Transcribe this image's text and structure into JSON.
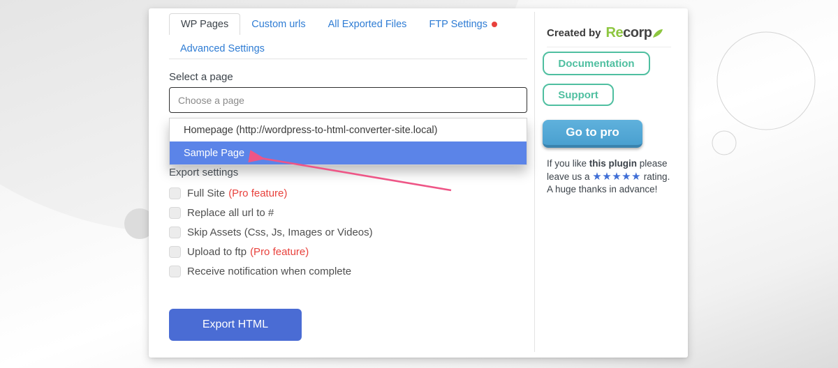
{
  "tabs": {
    "items": [
      {
        "label": "WP Pages",
        "active": true
      },
      {
        "label": "Custom urls",
        "active": false
      },
      {
        "label": "All Exported Files",
        "active": false
      },
      {
        "label": "FTP Settings",
        "active": false,
        "badge": "red-dot"
      },
      {
        "label": "Advanced Settings",
        "active": false
      }
    ]
  },
  "page_select": {
    "label": "Select a page",
    "placeholder": "Choose a page",
    "options": [
      {
        "label": "Homepage (http://wordpress-to-html-converter-site.local)",
        "highlighted": false
      },
      {
        "label": "Sample Page",
        "highlighted": true
      }
    ]
  },
  "export_settings": {
    "heading": "Export settings",
    "options": [
      {
        "label": "Full Site",
        "pro_note": "(Pro feature)",
        "checked": false
      },
      {
        "label": "Replace all url to #",
        "checked": false
      },
      {
        "label": "Skip Assets (Css, Js, Images or Videos)",
        "checked": false
      },
      {
        "label": "Upload to ftp",
        "pro_note": "(Pro feature)",
        "checked": false
      },
      {
        "label": "Receive notification when complete",
        "checked": false
      }
    ],
    "export_button_label": "Export HTML"
  },
  "sidebar": {
    "created_by_label": "Created by",
    "brand_name_part1": "Re",
    "brand_name_part2": "corp",
    "documentation_button_label": "Documentation",
    "support_button_label": "Support",
    "go_to_pro_button_label": "Go to pro",
    "rating_text": {
      "before_bold": "If you like ",
      "bold": "this plugin",
      "after_bold": " please leave us a ",
      "stars": "★★★★★",
      "after_stars": " rating.",
      "thanks_line": "A huge thanks in advance!"
    }
  },
  "icons": {
    "leaf": "leaf-icon",
    "ftp_notification": "notification-dot",
    "annotation": "selection-arrow"
  },
  "colors": {
    "link_blue": "#2e7cd4",
    "active_tab_text": "#3c434a",
    "notification_dot_red": "#e8413c",
    "pro_feature_red": "#e8413c",
    "dropdown_highlight_blue": "#5b84e8",
    "export_button_blue": "#4a6cd4",
    "brand_green": "#8dc63f",
    "teal_button": "#4fbfa0",
    "go_to_pro_blue": "#4fa7d6",
    "star_blue": "#3f6ed6",
    "arrow_pink": "#ee5586"
  }
}
